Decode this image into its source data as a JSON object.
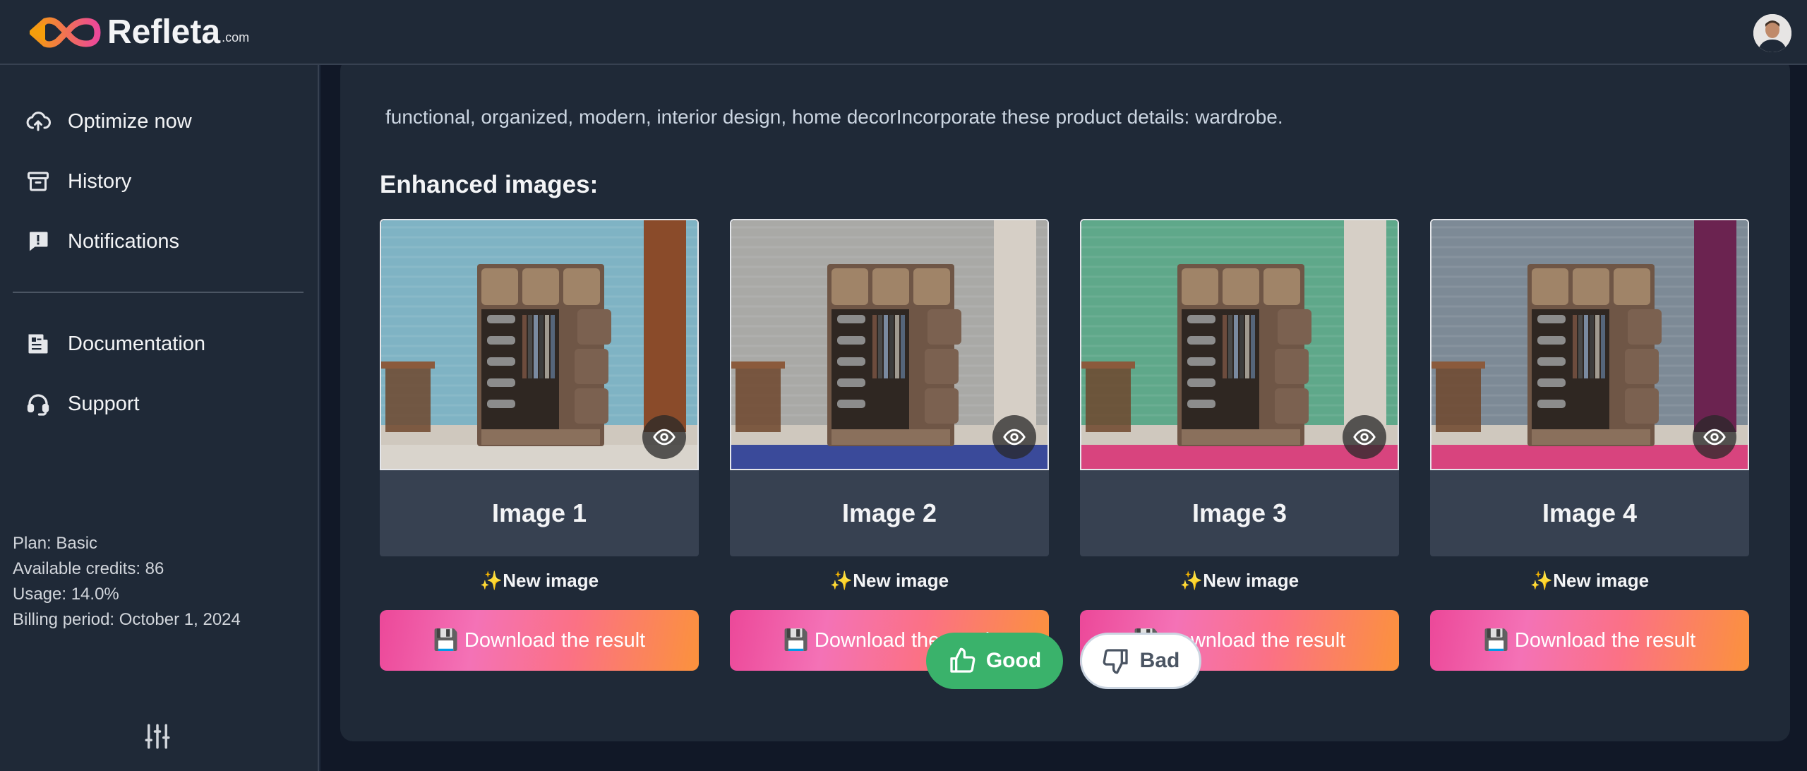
{
  "app": {
    "logo_text": "Refleta",
    "logo_suffix": ".com"
  },
  "sidebar": {
    "items": [
      {
        "label": "Optimize now",
        "icon": "cloud-upload-icon"
      },
      {
        "label": "History",
        "icon": "archive-icon"
      },
      {
        "label": "Notifications",
        "icon": "message-alert-icon"
      },
      {
        "label": "Documentation",
        "icon": "document-icon"
      },
      {
        "label": "Support",
        "icon": "headset-icon"
      }
    ],
    "plan": "Plan: Basic",
    "credits": "Available credits: 86",
    "usage": "Usage: 14.0%",
    "billing": "Billing period: October 1, 2024"
  },
  "main": {
    "cut_text": "functional, organized, modern, interior design, home decorIncorporate these product details: wardrobe.",
    "heading": "Enhanced images:",
    "cards": [
      {
        "caption": "Image 1",
        "new_label": "✨New image",
        "download_label": "💾 Download the result",
        "wall": "#7fb3c4",
        "floor": "#d9d4cc"
      },
      {
        "caption": "Image 2",
        "new_label": "✨New image",
        "download_label": "💾 Download the result",
        "wall": "#a9a9a6",
        "floor": "#3a4a9a"
      },
      {
        "caption": "Image 3",
        "new_label": "✨New image",
        "download_label": "💾 Download the result",
        "wall": "#5fa88a",
        "floor": "#d8447e"
      },
      {
        "caption": "Image 4",
        "new_label": "✨New image",
        "download_label": "💾 Download the result",
        "wall": "#7d8a96",
        "floor": "#d8447e"
      }
    ],
    "good_label": "Good",
    "bad_label": "Bad"
  },
  "colors": {
    "accent_start": "#ec4899",
    "accent_end": "#fb923c",
    "good": "#3ab26b"
  }
}
